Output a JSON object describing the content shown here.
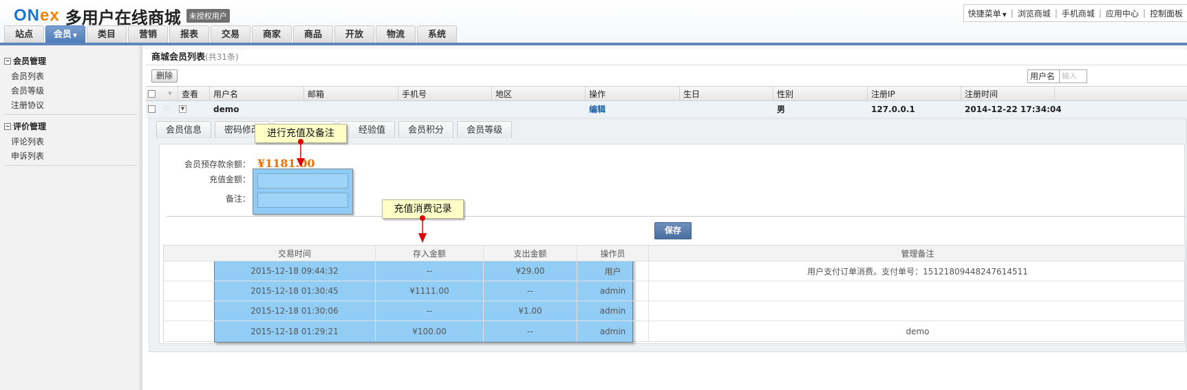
{
  "header": {
    "logo_part1": "ON",
    "logo_part2": "ex",
    "site_title": "多用户在线商城",
    "license_badge": "未授权用户",
    "quick_menu": {
      "label": "快捷菜单",
      "links": [
        "浏览商城",
        "手机商城",
        "应用中心",
        "控制面板"
      ]
    }
  },
  "nav": {
    "tabs": [
      "站点",
      "会员",
      "类目",
      "营销",
      "报表",
      "交易",
      "商家",
      "商品",
      "开放",
      "物流",
      "系统"
    ],
    "active": "会员"
  },
  "sidebar": {
    "groups": [
      {
        "title": "会员管理",
        "items": [
          "会员列表",
          "会员等级",
          "注册协议"
        ]
      },
      {
        "title": "评价管理",
        "items": [
          "评论列表",
          "申诉列表"
        ]
      }
    ]
  },
  "page": {
    "title": "商城会员列表",
    "count": "(共31条)",
    "delete_label": "删除",
    "search_field": "用户名",
    "search_placeholder": "输入"
  },
  "grid": {
    "columns": [
      "查看",
      "用户名",
      "邮箱",
      "手机号",
      "地区",
      "操作",
      "生日",
      "性别",
      "注册IP",
      "注册时间"
    ],
    "row": {
      "username": "demo",
      "email": "",
      "phone": "",
      "region": "",
      "action": "编辑",
      "birthday": "",
      "gender": "男",
      "ip": "127.0.0.1",
      "reg_time": "2014-12-22 17:34:04"
    }
  },
  "detail": {
    "tabs": [
      "会员信息",
      "密码修改",
      "",
      "经验值",
      "会员积分",
      "会员等级"
    ],
    "balance_label": "会员预存款余额：",
    "balance": "¥1181.00",
    "recharge_label": "充值金额：",
    "remark_label": "备注：",
    "save_label": "保存",
    "log": {
      "headers": [
        "交易时间",
        "存入金额",
        "支出金额",
        "操作员",
        "管理备注"
      ],
      "rows": [
        [
          "2015-12-18 09:44:32",
          "--",
          "¥29.00",
          "用户",
          "用户支付订单消费。支付单号：15121809448247614511"
        ],
        [
          "2015-12-18 01:30:45",
          "¥1111.00",
          "--",
          "admin",
          ""
        ],
        [
          "2015-12-18 01:30:06",
          "--",
          "¥1.00",
          "admin",
          ""
        ],
        [
          "2015-12-18 01:29:21",
          "¥100.00",
          "--",
          "admin",
          "demo"
        ]
      ]
    }
  },
  "callouts": {
    "recharge": "进行充值及备注",
    "records": "充值消费记录"
  },
  "colors": {
    "nav_active": "#5e86bd",
    "balance": "#f26d00",
    "highlight": "#8fcbf5",
    "callout_bg": "#ffffc8",
    "arrow": "#e00000"
  }
}
